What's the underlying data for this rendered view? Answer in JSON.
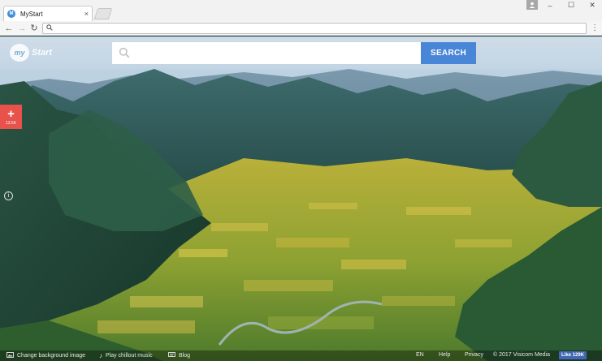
{
  "browser": {
    "tab_title": "MyStart",
    "tab_favicon": "M",
    "tab_close": "×",
    "profile_icon": "person-icon",
    "window_controls": {
      "minimize": "–",
      "maximize": "☐",
      "close": "✕"
    },
    "nav": {
      "back": "←",
      "forward": "→",
      "reload": "↻"
    },
    "address_value": "",
    "menu": "⋮"
  },
  "page": {
    "logo": {
      "badge": "my",
      "text": "Start"
    },
    "search": {
      "placeholder": "",
      "button_label": "SEARCH"
    },
    "add_widget": {
      "symbol": "+",
      "count": "13.5K"
    },
    "info_symbol": "i",
    "footer": {
      "change_bg": "Change background image",
      "music": "Play chillout music",
      "blog": "Blog",
      "language": "EN",
      "help": "Help",
      "privacy": "Privacy",
      "copyright": "© 2017 Visicom Media",
      "fb_like": "Like 129K"
    }
  },
  "colors": {
    "search_button": "#4a86d8",
    "add_widget": "#e8524a",
    "facebook": "#4267b2"
  }
}
